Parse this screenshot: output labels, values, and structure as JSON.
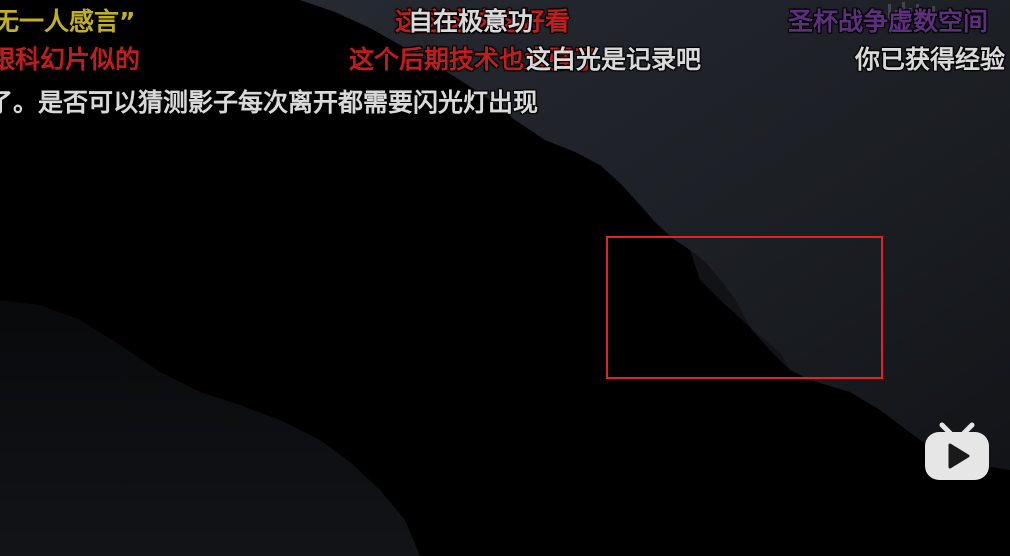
{
  "danmaku": [
    {
      "text": "无一人感言”",
      "color": "#c2b11e"
    },
    {
      "text": "这这这这这好看",
      "color": "#c11d1d"
    },
    {
      "text": "自在极意功",
      "color": "#d9d9d9"
    },
    {
      "text": "圣杯战争虚数空间",
      "color": "#5e2f7e"
    },
    {
      "text": "跟科幻片似的",
      "color": "#c11d1d"
    },
    {
      "text": "这个后期技术也太强了",
      "color": "#c11d1d"
    },
    {
      "text": "这白光是记录吧",
      "color": "#d9d9d9"
    },
    {
      "text": "你已获得经验",
      "color": "#d9d9d9"
    },
    {
      "text": "了。是否可以猜测影子每次离开都需要闪光灯出现",
      "color": "#d9d9d9"
    }
  ],
  "watermark": {
    "text": "哔哩哔哩"
  },
  "colors": {
    "selection_border": "#e02424",
    "background": "#000000",
    "video_gray": "#1c1f24"
  },
  "icons": {
    "play_button": "bilibili-tv-play-icon"
  }
}
